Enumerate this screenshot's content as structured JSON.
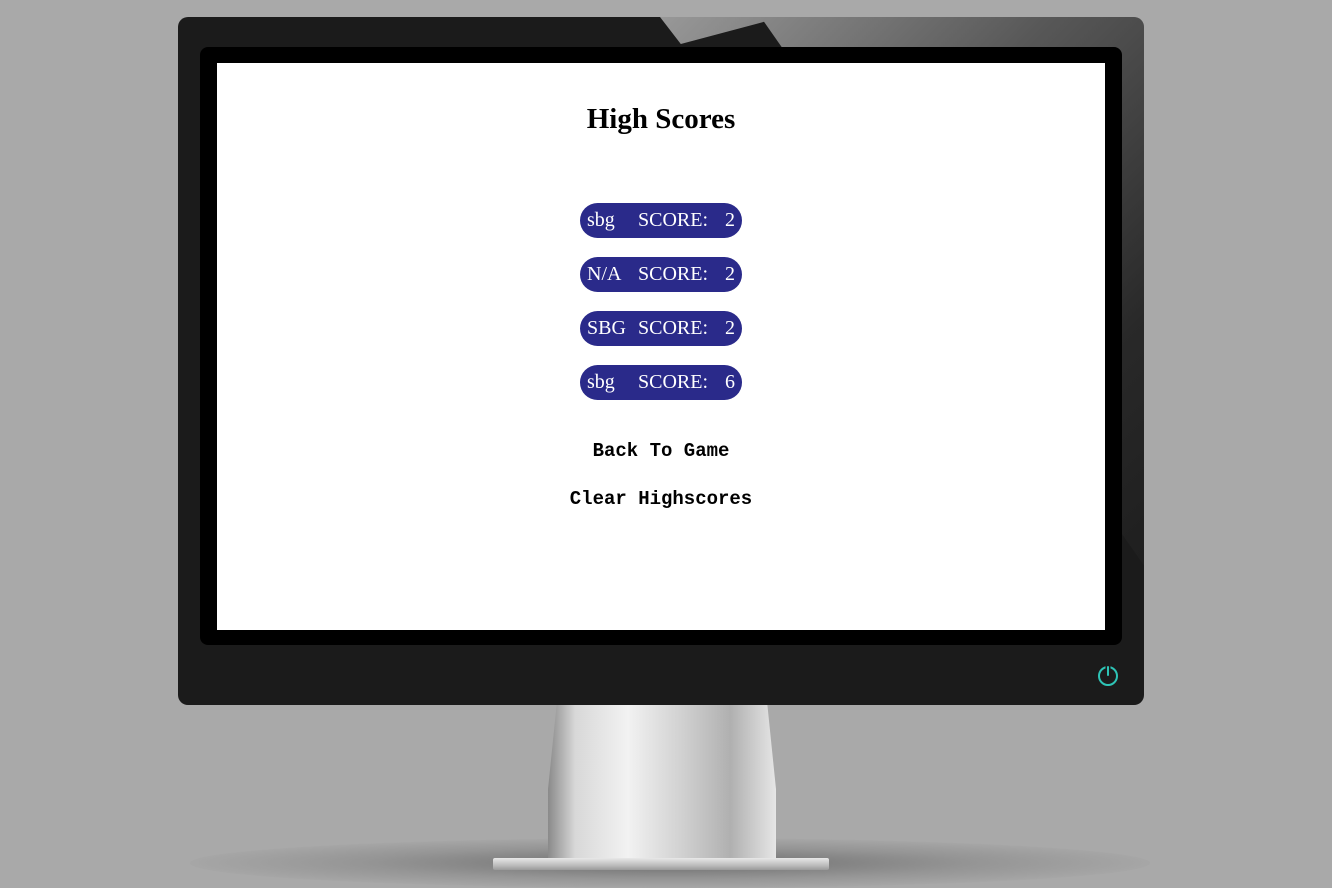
{
  "page": {
    "title": "High Scores"
  },
  "scores": [
    {
      "name": "sbg",
      "label": "SCORE:",
      "value": "2"
    },
    {
      "name": "N/A",
      "label": "SCORE:",
      "value": "2"
    },
    {
      "name": "SBG",
      "label": "SCORE:",
      "value": "2"
    },
    {
      "name": "sbg",
      "label": "SCORE:",
      "value": "6"
    }
  ],
  "actions": {
    "back_label": "Back To Game",
    "clear_label": "Clear Highscores"
  },
  "icons": {
    "power": "power-icon"
  },
  "colors": {
    "score_pill": "#2a2a8a",
    "power_accent": "#2ec4b6",
    "monitor_frame": "#1b1b1b",
    "background": "#a9a9a9"
  }
}
